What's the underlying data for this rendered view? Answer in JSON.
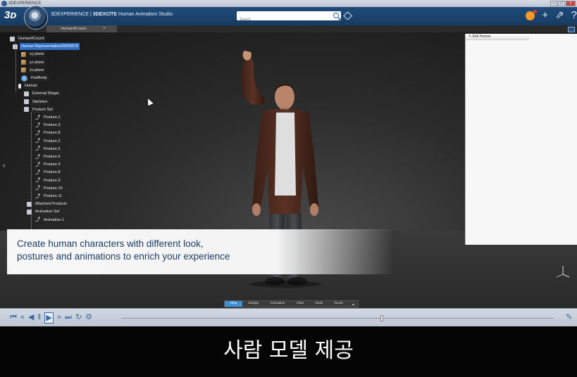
{
  "os": {
    "title": "3DEXPERIENCE"
  },
  "header": {
    "app_title_prefix": "3DEXPERIENCE | ",
    "app_title_main": "3DEXCITE",
    "app_title_suffix": " Human Animation Studio",
    "search_placeholder": "Search"
  },
  "tabs": {
    "active": "Human4Couch"
  },
  "tree": {
    "nodes": [
      {
        "label": "Human4Couch",
        "icon": "root-icon"
      },
      {
        "label": "Human Representation00003970",
        "icon": "human-rep-icon"
      },
      {
        "label": "xy plane",
        "icon": "plane-icon"
      },
      {
        "label": "yz plane",
        "icon": "plane-icon"
      },
      {
        "label": "zx plane",
        "icon": "plane-icon"
      },
      {
        "label": "PartBody",
        "icon": "partbody-icon"
      },
      {
        "label": "Human",
        "icon": "human-icon"
      },
      {
        "label": "External Shape",
        "icon": "shape-icon"
      },
      {
        "label": "Skeleton",
        "icon": "skeleton-icon"
      },
      {
        "label": "Posture Set",
        "icon": "posture-set-icon"
      },
      {
        "label": "Posture.1",
        "icon": "posture-icon"
      },
      {
        "label": "Posture.3",
        "icon": "posture-icon"
      },
      {
        "label": "Posture.8",
        "icon": "posture-icon"
      },
      {
        "label": "Posture.2",
        "icon": "posture-icon"
      },
      {
        "label": "Posture.5",
        "icon": "posture-icon"
      },
      {
        "label": "Posture.6",
        "icon": "posture-icon"
      },
      {
        "label": "Posture.4",
        "icon": "posture-icon"
      },
      {
        "label": "Posture.8",
        "icon": "posture-icon"
      },
      {
        "label": "Posture.9",
        "icon": "posture-icon"
      },
      {
        "label": "Posture.10",
        "icon": "posture-icon"
      },
      {
        "label": "Posture.11",
        "icon": "posture-icon"
      },
      {
        "label": "Attached Products",
        "icon": "attached-products-icon"
      },
      {
        "label": "Animation Set",
        "icon": "animation-set-icon"
      },
      {
        "label": "Animation.1",
        "icon": "animation-icon"
      }
    ]
  },
  "right_panel": {
    "title": "Edit Human"
  },
  "caption": {
    "line1": "Create human characters with different look,",
    "line2": "postures and animations to enrich your experience"
  },
  "command_tabs": [
    "Play",
    "Design",
    "Animation",
    "View",
    "Tools",
    "Touch"
  ],
  "subtitle": "사람 모델 제공",
  "colors": {
    "header": "#1f4b7a",
    "selection": "#2f6fc2",
    "caption_text": "#1c3d63",
    "active_tab": "#3d8fd6"
  }
}
